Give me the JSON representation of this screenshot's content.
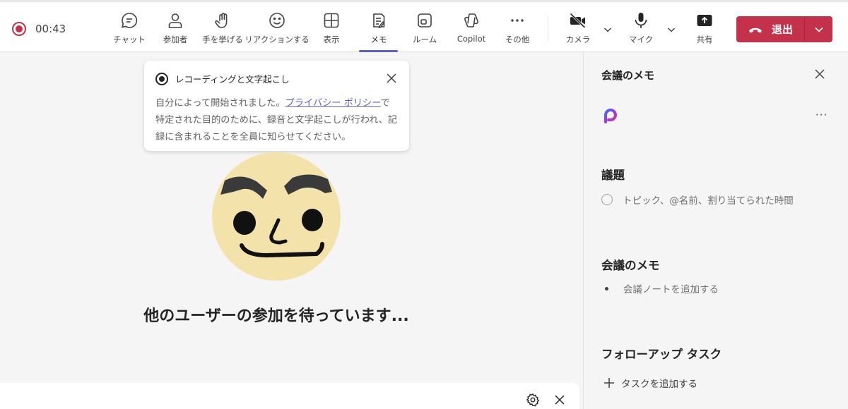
{
  "toolbar": {
    "timer": "00:43",
    "buttons": [
      {
        "label": "チャット"
      },
      {
        "label": "参加者"
      },
      {
        "label": "手を挙げる"
      },
      {
        "label": "リアクションする"
      },
      {
        "label": "表示"
      },
      {
        "label": "メモ"
      },
      {
        "label": "ルーム"
      },
      {
        "label": "Copilot"
      },
      {
        "label": "その他"
      },
      {
        "label": "カメラ"
      },
      {
        "label": "マイク"
      },
      {
        "label": "共有"
      }
    ],
    "leave_label": "退出",
    "accent_color": "#5b5fc7",
    "leave_color": "#c4314b"
  },
  "tooltip": {
    "title": "レコーディングと文字起こし",
    "body_before": "自分によって開始されました。",
    "link": "プライバシー ポリシー",
    "body_after": "で特定された目的のために、録音と文字起こしが行われ、記録に含まれることを全員に知らせてください。"
  },
  "stage": {
    "waiting_text": "他のユーザーの参加を待っています..."
  },
  "notes_panel": {
    "title": "会議のメモ",
    "agenda_title": "議題",
    "agenda_placeholder": "トピック、@名前、割り当てられた時間",
    "notes_title": "会議のメモ",
    "notes_placeholder": "会議ノートを追加する",
    "followup_title": "フォローアップ タスク",
    "add_task": "タスクを追加する"
  }
}
